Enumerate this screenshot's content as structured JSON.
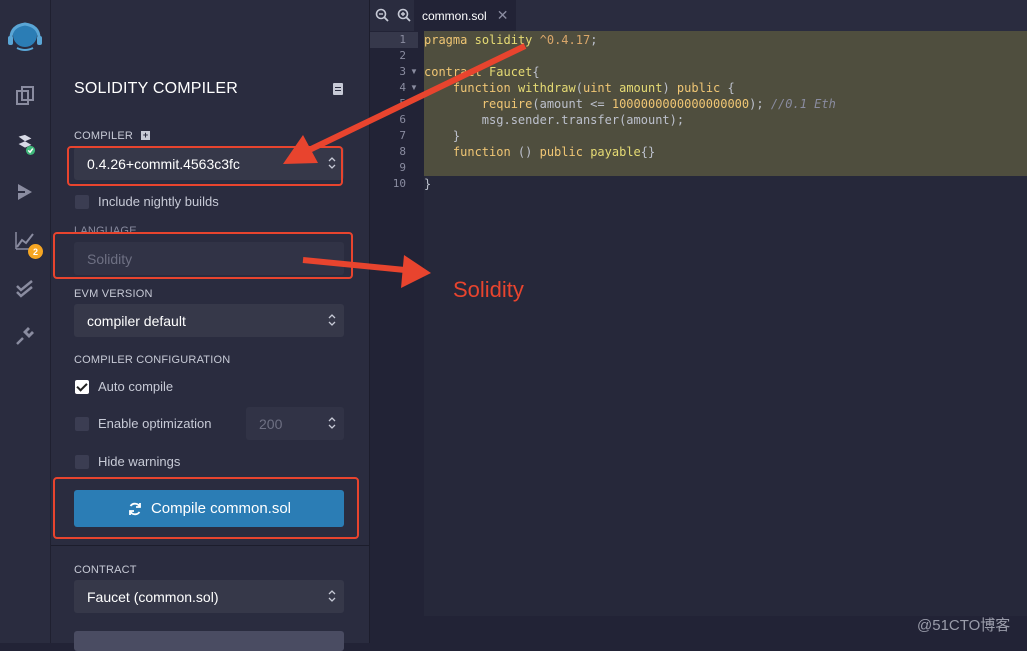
{
  "rail": {
    "badge_count": "2"
  },
  "panel": {
    "title": "SOLIDITY COMPILER",
    "compiler_label": "COMPILER",
    "compiler_plus": "+",
    "compiler_version": "0.4.26+commit.4563c3fc",
    "nightly_label": "Include nightly builds",
    "nightly_checked": false,
    "language_label": "LANGUAGE",
    "language_value": "Solidity",
    "evm_label": "EVM VERSION",
    "evm_value": "compiler default",
    "config_label": "COMPILER CONFIGURATION",
    "auto_compile_label": "Auto compile",
    "auto_compile_checked": true,
    "optimization_label": "Enable optimization",
    "optimization_runs": "200",
    "hide_warnings_label": "Hide warnings",
    "compile_button": "Compile common.sol",
    "contract_label": "CONTRACT",
    "contract_value": "Faucet (common.sol)"
  },
  "editor": {
    "tab_name": "common.sol",
    "tab_close": "✕",
    "line_numbers": [
      "1",
      "2",
      "3",
      "4",
      "5",
      "6",
      "7",
      "8",
      "9",
      "10"
    ]
  },
  "annotation": {
    "arrow_text": "Solidity"
  },
  "watermark": "@51CTO博客",
  "colors": {
    "accent": "#2b7db5",
    "annotation": "#e8442e",
    "badge": "#f6a623",
    "highlight": "#4f4e3e"
  }
}
